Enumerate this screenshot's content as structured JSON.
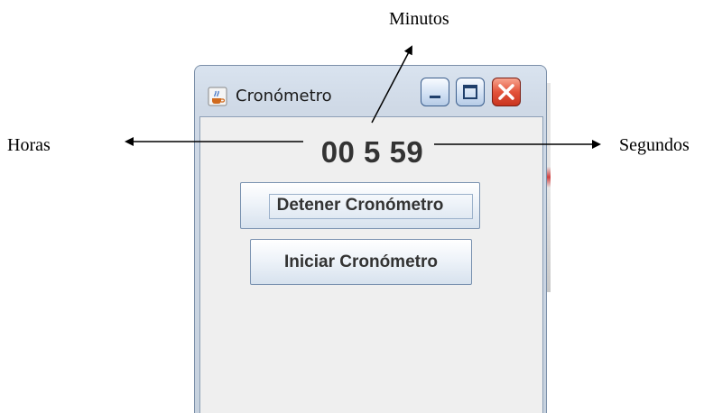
{
  "annotations": {
    "minutes_label": "Minutos",
    "hours_label": "Horas",
    "seconds_label": "Segundos"
  },
  "window": {
    "title": "Cronómetro",
    "app_icon": "java-coffee-cup-icon",
    "titlebar_buttons": [
      "minimize-icon",
      "maximize-icon",
      "close-icon"
    ]
  },
  "stopwatch": {
    "time": "00 5 59",
    "stop_label": "Detener Cronómetro",
    "start_label": "Iniciar Cronómetro"
  },
  "colors": {
    "close_button": "#e3533a",
    "window_frame": "#c6d1de",
    "panel_background": "#efefef"
  }
}
